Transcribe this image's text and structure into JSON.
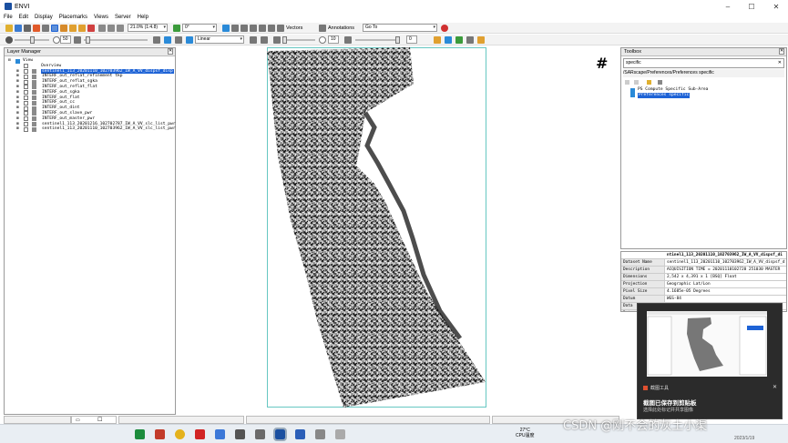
{
  "window": {
    "title": "ENVI"
  },
  "menu": [
    "File",
    "Edit",
    "Display",
    "Placemarks",
    "Views",
    "Server",
    "Help"
  ],
  "toolbar1": {
    "scale_field": "21.0% (1:4.8)",
    "rotation_field": "0°",
    "vectors_label": "Vectors",
    "annotations_label": "Annotations",
    "goto_label": "Go To"
  },
  "toolbar2": {
    "brightness_value": "50",
    "stretch_select": "Linear",
    "contrast_value": "10",
    "sharpen_value": "0"
  },
  "layer_manager": {
    "title": "Layer Manager",
    "view_label": "View",
    "overview_label": "Overview",
    "layers": [
      "sentinel1_113_20201110_102703962_IW_A_VV_dispsf_disp",
      "INTERF_out_reflat_refinement tkp",
      "INTERF_out_reflat_sgka",
      "INTERF_out_reflat_flat",
      "INTERF_out_sgka",
      "INTERF_out_flat",
      "INTERF_out_cc",
      "INTERF_out_dint",
      "INTERF_out_slave_pwr",
      "INTERF_out_master_pwr",
      "sentinel1_113_20201216_102702787_IW_A_VV_slc_list_pwr",
      "sentinel1_113_20201110_102703962_IW_A_VV_slc_list_pwr"
    ]
  },
  "image_overlay_symbol": "#",
  "toolbox": {
    "title": "Toolbox",
    "search_value": "specific",
    "path": "/SARscape/Preferences/Preferences specific",
    "items": [
      "PS Compute Specific Sub-Area",
      "Preferences specific"
    ]
  },
  "properties": {
    "header": "ntinel1_113_20201110_102703962_IW_A_VV_dispsf_di",
    "rows": [
      {
        "key": "Dataset Name",
        "value": "sentinel1_113_20201110_102703962_IW_A_VV_dispsf_d"
      },
      {
        "key": "Description",
        "value": "ACQUISITION TIME = 20201110102720 251030   MASTER"
      },
      {
        "key": "Dimensions",
        "value": "2,542 x 4,391 x 1 [BSQ] Float"
      },
      {
        "key": "Projection",
        "value": "Geographic Lat/Lon"
      },
      {
        "key": "Pixel Size",
        "value": "4.1685e-05 Degrees"
      },
      {
        "key": "Datum",
        "value": "WGS-84"
      },
      {
        "key": "Data",
        "value": ""
      },
      {
        "key": "Data",
        "value": ""
      }
    ]
  },
  "notification": {
    "app_label": "截图工具",
    "title": "截图已保存到剪贴板",
    "body": "选择此处标记并共享图像"
  },
  "taskbar": {
    "weather_temp": "27°C",
    "weather_label": "CPU温度",
    "date": "2023/1/19",
    "watermark": "CSDN @刚不会的灰土小渠"
  },
  "colors": {
    "selection": "#1e63d6",
    "image_border": "#66c7c2",
    "chrome": "#f3f3f3"
  }
}
